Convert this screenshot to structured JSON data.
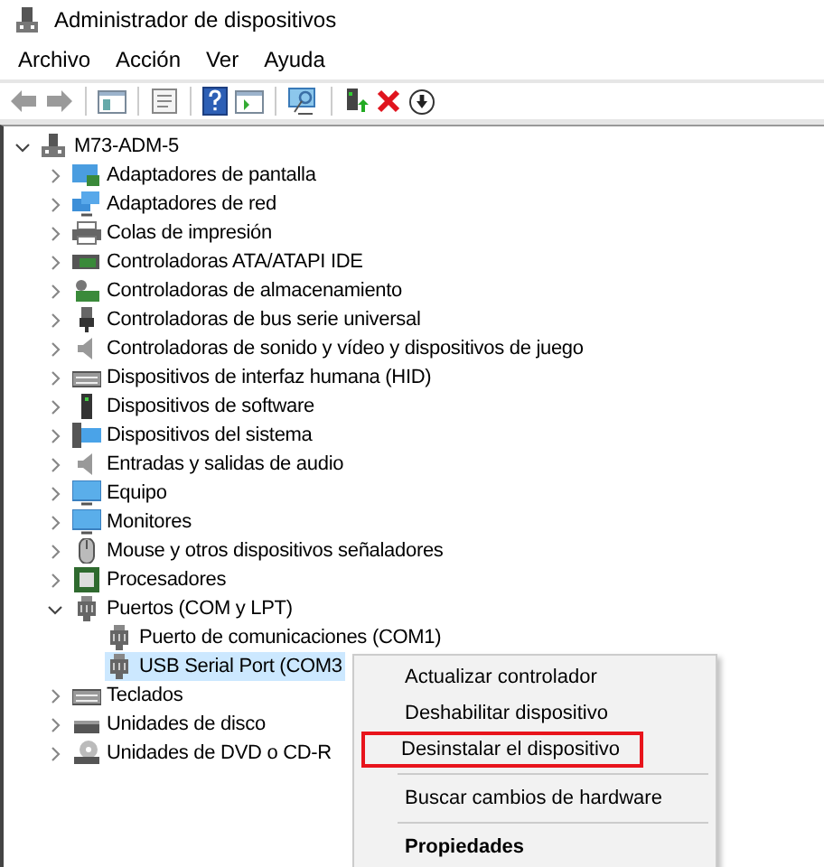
{
  "window": {
    "title": "Administrador de dispositivos"
  },
  "menu": [
    "Archivo",
    "Acción",
    "Ver",
    "Ayuda"
  ],
  "tree": {
    "label": "M73-ADM-5",
    "kind": "computer",
    "expanded": true,
    "children": [
      {
        "label": "Adaptadores de pantalla",
        "kind": "display",
        "expanded": false
      },
      {
        "label": "Adaptadores de red",
        "kind": "network",
        "expanded": false
      },
      {
        "label": "Colas de impresión",
        "kind": "printer",
        "expanded": false
      },
      {
        "label": "Controladoras ATA/ATAPI IDE",
        "kind": "board",
        "expanded": false
      },
      {
        "label": "Controladoras de almacenamiento",
        "kind": "storage",
        "expanded": false
      },
      {
        "label": "Controladoras de bus serie universal",
        "kind": "usb",
        "expanded": false
      },
      {
        "label": "Controladoras de sonido y vídeo y dispositivos de juego",
        "kind": "speaker",
        "expanded": false
      },
      {
        "label": "Dispositivos de interfaz humana (HID)",
        "kind": "keyboard",
        "expanded": false
      },
      {
        "label": "Dispositivos de software",
        "kind": "tower",
        "expanded": false
      },
      {
        "label": "Dispositivos del sistema",
        "kind": "system",
        "expanded": false
      },
      {
        "label": "Entradas y salidas de audio",
        "kind": "speaker",
        "expanded": false
      },
      {
        "label": "Equipo",
        "kind": "monitor",
        "expanded": false
      },
      {
        "label": "Monitores",
        "kind": "monitor",
        "expanded": false
      },
      {
        "label": "Mouse y otros dispositivos señaladores",
        "kind": "mouse",
        "expanded": false
      },
      {
        "label": "Procesadores",
        "kind": "chip",
        "expanded": false
      },
      {
        "label": "Puertos (COM y LPT)",
        "kind": "port",
        "expanded": true,
        "children": [
          {
            "label": "Puerto de comunicaciones (COM1)",
            "kind": "port",
            "selected": false
          },
          {
            "label": "USB Serial Port (COM3",
            "kind": "port",
            "selected": true
          }
        ]
      },
      {
        "label": "Teclados",
        "kind": "keyboard",
        "expanded": false
      },
      {
        "label": "Unidades de disco",
        "kind": "disk",
        "expanded": false
      },
      {
        "label": "Unidades de DVD o CD-R",
        "kind": "dvd",
        "expanded": false
      }
    ]
  },
  "context_menu": [
    {
      "kind": "item",
      "label": "Actualizar controlador",
      "highlighted": false,
      "bold": false
    },
    {
      "kind": "item",
      "label": "Deshabilitar dispositivo",
      "highlighted": false,
      "bold": false
    },
    {
      "kind": "item",
      "label": "Desinstalar el dispositivo",
      "highlighted": true,
      "bold": false
    },
    {
      "kind": "separator"
    },
    {
      "kind": "item",
      "label": "Buscar cambios de hardware",
      "highlighted": false,
      "bold": false
    },
    {
      "kind": "separator"
    },
    {
      "kind": "item",
      "label": "Propiedades",
      "highlighted": false,
      "bold": true
    }
  ]
}
